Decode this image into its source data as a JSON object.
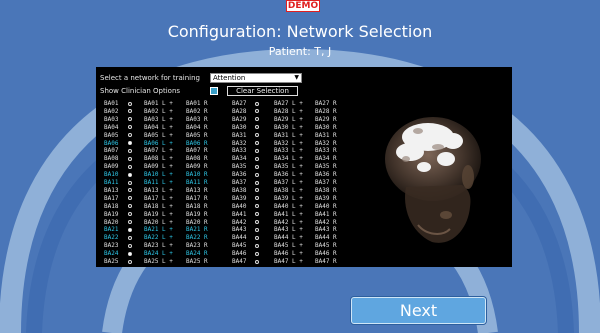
{
  "demo_badge": "DEMO",
  "header": {
    "title": "Configuration: Network Selection",
    "patient": "Patient: T, J"
  },
  "panel": {
    "select_label": "Select a network for training",
    "selected_network": "Attention",
    "show_clinician_label": "Show Clinician Options",
    "clear_selection_label": "Clear Selection"
  },
  "left_table": {
    "rows": [
      {
        "ba": "BA01",
        "l": "BA01 L +",
        "r": "BA01 R",
        "selected": false,
        "highlighted": false
      },
      {
        "ba": "BA02",
        "l": "BA02 L +",
        "r": "BA02 R",
        "selected": false,
        "highlighted": false
      },
      {
        "ba": "BA03",
        "l": "BA03 L +",
        "r": "BA03 R",
        "selected": false,
        "highlighted": false
      },
      {
        "ba": "BA04",
        "l": "BA04 L +",
        "r": "BA04 R",
        "selected": false,
        "highlighted": false
      },
      {
        "ba": "BA05",
        "l": "BA05 L +",
        "r": "BA05 R",
        "selected": false,
        "highlighted": false
      },
      {
        "ba": "BA06",
        "l": "BA06 L +",
        "r": "BA06 R",
        "selected": true,
        "highlighted": true
      },
      {
        "ba": "BA07",
        "l": "BA07 L +",
        "r": "BA07 R",
        "selected": false,
        "highlighted": false
      },
      {
        "ba": "BA08",
        "l": "BA08 L +",
        "r": "BA08 R",
        "selected": false,
        "highlighted": false
      },
      {
        "ba": "BA09",
        "l": "BA09 L +",
        "r": "BA09 R",
        "selected": false,
        "highlighted": false
      },
      {
        "ba": "BA10",
        "l": "BA10 L +",
        "r": "BA10 R",
        "selected": true,
        "highlighted": true
      },
      {
        "ba": "BA11",
        "l": "BA11 L +",
        "r": "BA11 R",
        "selected": false,
        "highlighted": true
      },
      {
        "ba": "BA13",
        "l": "BA13 L +",
        "r": "BA13 R",
        "selected": false,
        "highlighted": false
      },
      {
        "ba": "BA17",
        "l": "BA17 L +",
        "r": "BA17 R",
        "selected": false,
        "highlighted": false
      },
      {
        "ba": "BA18",
        "l": "BA18 L +",
        "r": "BA18 R",
        "selected": false,
        "highlighted": false
      },
      {
        "ba": "BA19",
        "l": "BA19 L +",
        "r": "BA19 R",
        "selected": false,
        "highlighted": false
      },
      {
        "ba": "BA20",
        "l": "BA20 L +",
        "r": "BA20 R",
        "selected": false,
        "highlighted": false
      },
      {
        "ba": "BA21",
        "l": "BA21 L +",
        "r": "BA21 R",
        "selected": true,
        "highlighted": true
      },
      {
        "ba": "BA22",
        "l": "BA22 L +",
        "r": "BA22 R",
        "selected": false,
        "highlighted": true
      },
      {
        "ba": "BA23",
        "l": "BA23 L +",
        "r": "BA23 R",
        "selected": false,
        "highlighted": false
      },
      {
        "ba": "BA24",
        "l": "BA24 L +",
        "r": "BA24 R",
        "selected": true,
        "highlighted": true
      },
      {
        "ba": "BA25",
        "l": "BA25 L +",
        "r": "BA25 R",
        "selected": false,
        "highlighted": false
      }
    ]
  },
  "right_table": {
    "rows": [
      {
        "ba": "BA27",
        "l": "BA27 L +",
        "r": "BA27 R"
      },
      {
        "ba": "BA28",
        "l": "BA28 L +",
        "r": "BA28 R"
      },
      {
        "ba": "BA29",
        "l": "BA29 L +",
        "r": "BA29 R"
      },
      {
        "ba": "BA30",
        "l": "BA30 L +",
        "r": "BA30 R"
      },
      {
        "ba": "BA31",
        "l": "BA31 L +",
        "r": "BA31 R"
      },
      {
        "ba": "BA32",
        "l": "BA32 L +",
        "r": "BA32 R"
      },
      {
        "ba": "BA33",
        "l": "BA33 L +",
        "r": "BA33 R"
      },
      {
        "ba": "BA34",
        "l": "BA34 L +",
        "r": "BA34 R"
      },
      {
        "ba": "BA35",
        "l": "BA35 L +",
        "r": "BA35 R"
      },
      {
        "ba": "BA36",
        "l": "BA36 L +",
        "r": "BA36 R"
      },
      {
        "ba": "BA37",
        "l": "BA37 L +",
        "r": "BA37 R"
      },
      {
        "ba": "BA38",
        "l": "BA38 L +",
        "r": "BA38 R"
      },
      {
        "ba": "BA39",
        "l": "BA39 L +",
        "r": "BA39 R"
      },
      {
        "ba": "BA40",
        "l": "BA40 L +",
        "r": "BA40 R"
      },
      {
        "ba": "BA41",
        "l": "BA41 L +",
        "r": "BA41 R"
      },
      {
        "ba": "BA42",
        "l": "BA42 L +",
        "r": "BA42 R"
      },
      {
        "ba": "BA43",
        "l": "BA43 L +",
        "r": "BA43 R"
      },
      {
        "ba": "BA44",
        "l": "BA44 L +",
        "r": "BA44 R"
      },
      {
        "ba": "BA45",
        "l": "BA45 L +",
        "r": "BA45 R"
      },
      {
        "ba": "BA46",
        "l": "BA46 L +",
        "r": "BA46 R"
      },
      {
        "ba": "BA47",
        "l": "BA47 L +",
        "r": "BA47 R"
      }
    ]
  },
  "next_button": "Next",
  "colors": {
    "background": "#4a76b8",
    "arc": "#8fb0d8",
    "panel": "#000000",
    "highlight_text": "#2ec8e8",
    "next_button": "#5fa6e0",
    "demo_text": "#e02020"
  },
  "icons": {
    "dropdown": "chevron-down-icon",
    "head_model": "brain-head-3d-image"
  }
}
